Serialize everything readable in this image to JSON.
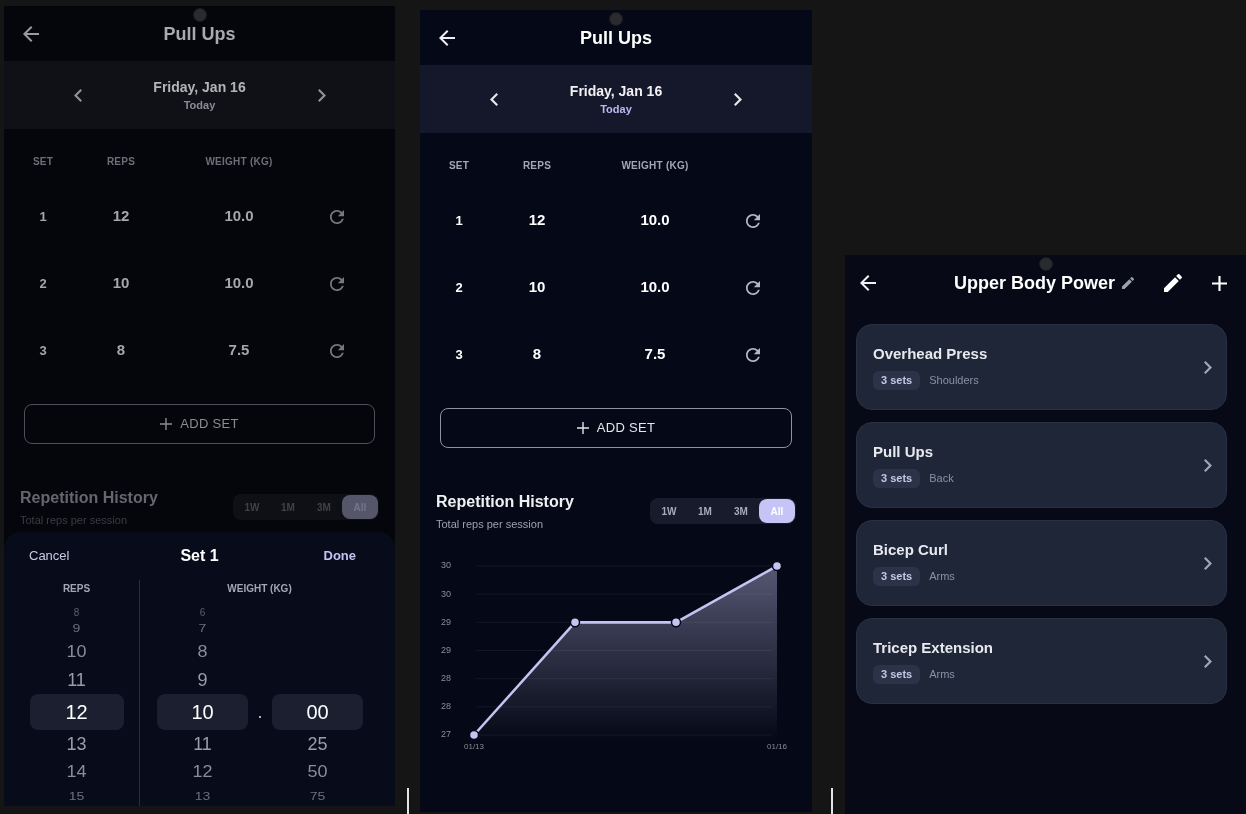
{
  "screens": [
    {
      "kind": "exercise",
      "dimmed": true,
      "title": "Pull Ups",
      "date": {
        "label": "Friday, Jan 16",
        "note": "Today"
      },
      "table": {
        "columns": [
          "SET",
          "REPS",
          "WEIGHT (KG)"
        ],
        "rows": [
          {
            "set": "1",
            "reps": "12",
            "weight": "10.0"
          },
          {
            "set": "2",
            "reps": "10",
            "weight": "10.0"
          },
          {
            "set": "3",
            "reps": "8",
            "weight": "7.5"
          }
        ]
      },
      "add_set_button": "ADD SET",
      "history": {
        "title": "Repetition History",
        "subtitle": "Total reps per session",
        "ranges": [
          {
            "label": "1W",
            "selected": false
          },
          {
            "label": "1M",
            "selected": false
          },
          {
            "label": "3M",
            "selected": false
          },
          {
            "label": "All",
            "selected": true
          }
        ]
      },
      "sheet": {
        "cancel_button": "Cancel",
        "title": "Set 1",
        "done_button": "Done",
        "pickers": [
          {
            "header": "REPS",
            "wheels": [
              {
                "items": [
                  {
                    "value": "8",
                    "selected": false
                  },
                  {
                    "value": "9",
                    "selected": false
                  },
                  {
                    "value": "10",
                    "selected": false
                  },
                  {
                    "value": "11",
                    "selected": false
                  },
                  {
                    "value": "12",
                    "selected": true
                  },
                  {
                    "value": "13",
                    "selected": false
                  },
                  {
                    "value": "14",
                    "selected": false
                  },
                  {
                    "value": "15",
                    "selected": false
                  }
                ]
              }
            ]
          },
          {
            "header": "WEIGHT (KG)",
            "separator": ".",
            "wheels": [
              {
                "items": [
                  {
                    "value": "6",
                    "selected": false
                  },
                  {
                    "value": "7",
                    "selected": false
                  },
                  {
                    "value": "8",
                    "selected": false
                  },
                  {
                    "value": "9",
                    "selected": false
                  },
                  {
                    "value": "10",
                    "selected": true
                  },
                  {
                    "value": "11",
                    "selected": false
                  },
                  {
                    "value": "12",
                    "selected": false
                  },
                  {
                    "value": "13",
                    "selected": false
                  }
                ]
              },
              {
                "items": [
                  {
                    "value": "00",
                    "selected": true
                  },
                  {
                    "value": "25",
                    "selected": false
                  },
                  {
                    "value": "50",
                    "selected": false
                  },
                  {
                    "value": "75",
                    "selected": false
                  }
                ]
              }
            ]
          }
        ]
      }
    },
    {
      "kind": "exercise",
      "dimmed": false,
      "title": "Pull Ups",
      "date": {
        "label": "Friday, Jan 16",
        "note": "Today"
      },
      "table": {
        "columns": [
          "SET",
          "REPS",
          "WEIGHT (KG)"
        ],
        "rows": [
          {
            "set": "1",
            "reps": "12",
            "weight": "10.0"
          },
          {
            "set": "2",
            "reps": "10",
            "weight": "10.0"
          },
          {
            "set": "3",
            "reps": "8",
            "weight": "7.5"
          }
        ]
      },
      "add_set_button": "ADD SET",
      "history": {
        "title": "Repetition History",
        "subtitle": "Total reps per session",
        "ranges": [
          {
            "label": "1W",
            "selected": false
          },
          {
            "label": "1M",
            "selected": false
          },
          {
            "label": "3M",
            "selected": false
          },
          {
            "label": "All",
            "selected": true
          }
        ],
        "chart_data": {
          "type": "area",
          "categories": [
            "01/13",
            null,
            null,
            "01/16"
          ],
          "ylim": [
            27,
            30
          ],
          "yticks": [
            {
              "value": 30,
              "label": "30"
            },
            {
              "value": 29.5,
              "label": "30"
            },
            {
              "value": 29,
              "label": "29"
            },
            {
              "value": 28.5,
              "label": "29"
            },
            {
              "value": 28,
              "label": "28"
            },
            {
              "value": 27.5,
              "label": "28"
            },
            {
              "value": 27,
              "label": "27"
            }
          ],
          "grid": true,
          "series": [
            {
              "color": "#c5c3f2",
              "values": [
                27,
                29,
                29,
                30
              ]
            }
          ]
        }
      }
    },
    {
      "kind": "workout",
      "title": "Upper Body Power",
      "exercises": [
        {
          "name": "Overhead Press",
          "badge": "3 sets",
          "muscle": "Shoulders"
        },
        {
          "name": "Pull Ups",
          "badge": "3 sets",
          "muscle": "Back"
        },
        {
          "name": "Bicep Curl",
          "badge": "3 sets",
          "muscle": "Arms"
        },
        {
          "name": "Tricep Extension",
          "badge": "3 sets",
          "muscle": "Arms"
        }
      ]
    }
  ]
}
